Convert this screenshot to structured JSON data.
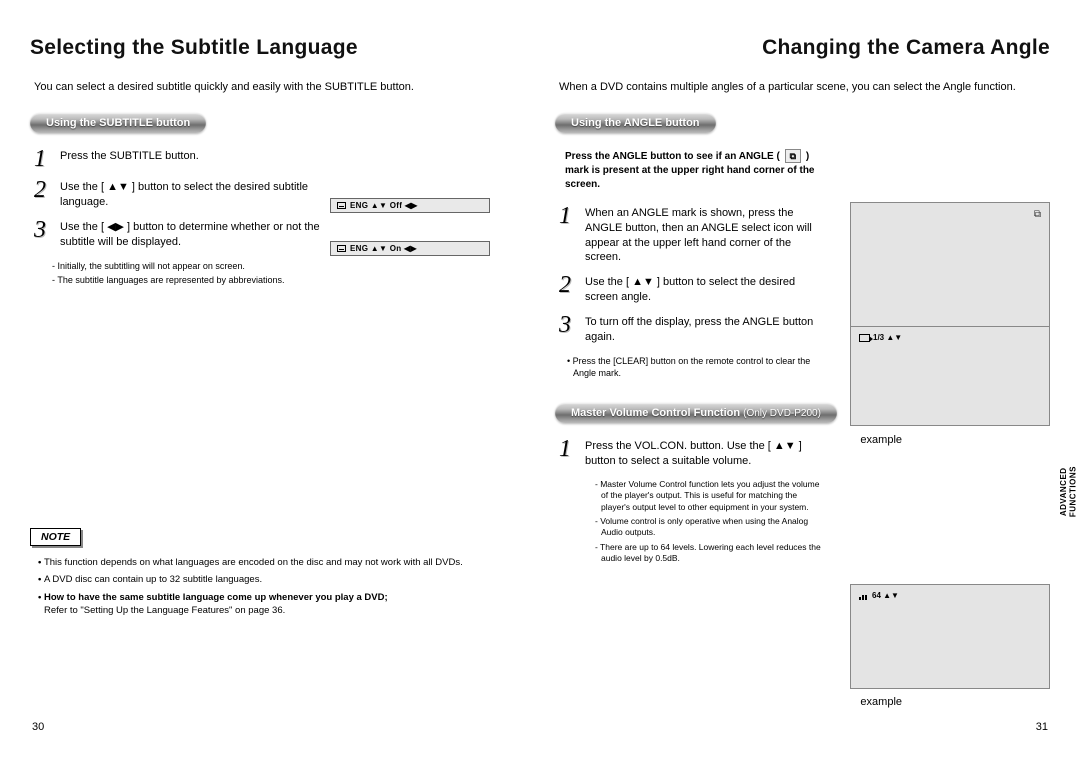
{
  "left": {
    "title": "Selecting the Subtitle Language",
    "intro": "You can select a desired subtitle quickly and easily with the SUBTITLE button.",
    "section": "Using the SUBTITLE button",
    "steps": [
      "Press the SUBTITLE button.",
      "Use the [ ▲▼ ] button to select the desired subtitle language.",
      "Use the [ ◀▶ ] button to determine whether or not the subtitle will be displayed."
    ],
    "subnotes": [
      "Initially, the subtitling will not appear on screen.",
      "The subtitle languages are represented by abbreviations."
    ],
    "osd": [
      "ENG  ▲▼  Off  ◀▶",
      "ENG  ▲▼  On  ◀▶"
    ],
    "note_heading": "NOTE",
    "notes": [
      "This function depends on what languages are encoded on the disc and may not work with all DVDs.",
      "A DVD disc can contain up to 32 subtitle languages.",
      "How to have the same subtitle language come up whenever you play a DVD;"
    ],
    "notes_ref": "Refer to \"Setting Up the Language Features\" on page 36.",
    "page_num": "30"
  },
  "right": {
    "title": "Changing the Camera Angle",
    "intro": "When a DVD contains multiple angles of a particular scene, you can select the Angle function.",
    "section_a": "Using the ANGLE button",
    "intro_bold_a": "Press the ANGLE button to see if an ANGLE (",
    "intro_bold_b": ") mark is present at the upper right hand corner of the screen.",
    "steps_a": [
      "When an ANGLE mark is shown, press the ANGLE button, then an ANGLE select icon will appear at the upper left hand corner of the screen.",
      "Use the [ ▲▼ ] button to select the desired screen angle.",
      "To turn off the display, press the ANGLE button again."
    ],
    "clear_note": "Press the [CLEAR] button on the remote control to clear the Angle mark.",
    "osd_angle": "1/3  ▲▼",
    "example": "example",
    "section_b": "Master Volume Control Function",
    "section_b_suffix": "(Only DVD-P200)",
    "steps_b": [
      "Press the VOL.CON. button. Use the [ ▲▼ ] button to select a suitable volume."
    ],
    "mvc_notes": [
      "Master Volume Control function lets you adjust the volume of the player's output. This is useful for matching the player's output level to other equipment in your system.",
      "Volume control is only operative when using the Analog Audio outputs.",
      "There are up to 64 levels. Lowering each level reduces the audio level by 0.5dB."
    ],
    "osd_vol": "64  ▲▼",
    "page_num": "31",
    "side_tab_a": "ADVANCED",
    "side_tab_b": "FUNCTIONS"
  }
}
